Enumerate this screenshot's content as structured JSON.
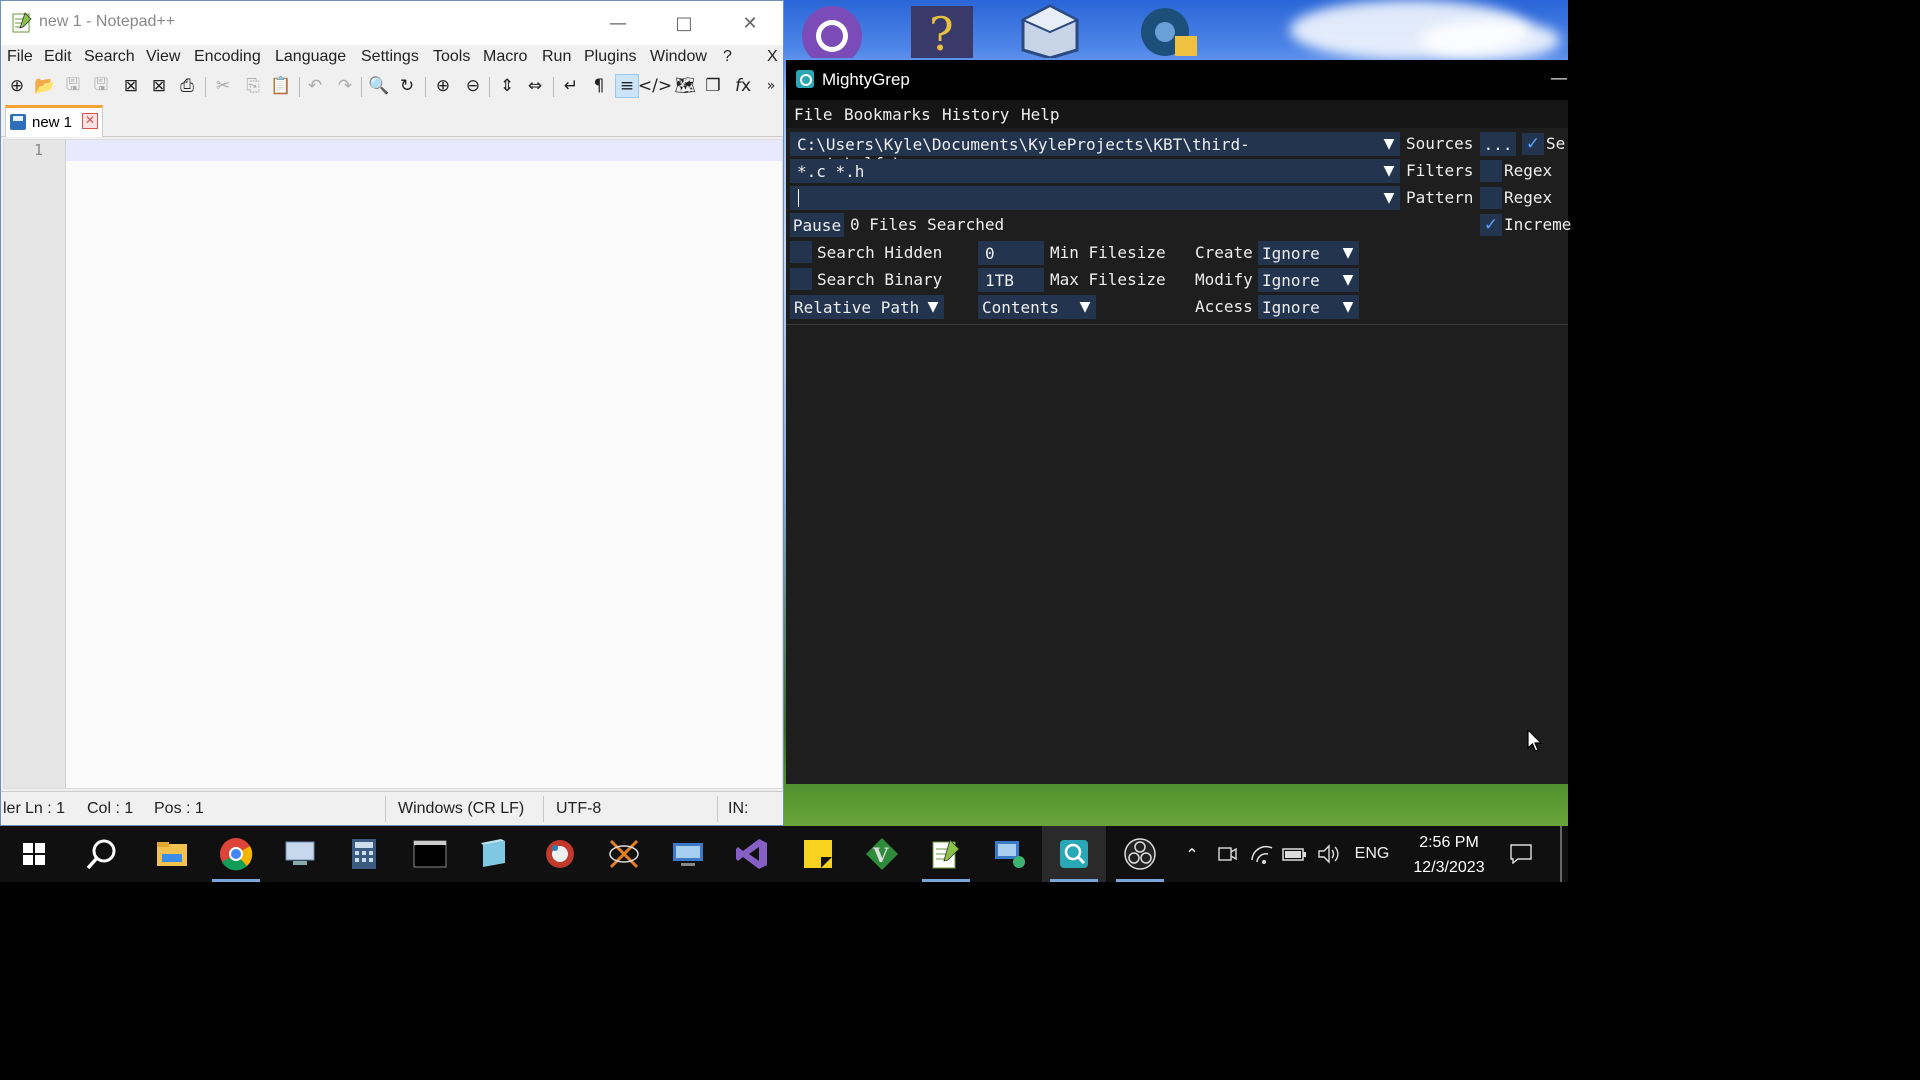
{
  "notepad": {
    "title": "new 1 - Notepad++",
    "menu": [
      "File",
      "Edit",
      "Search",
      "View",
      "Encoding",
      "Language",
      "Settings",
      "Tools",
      "Macro",
      "Run",
      "Plugins",
      "Window",
      "?"
    ],
    "close_x": "X",
    "toolbar_icons": [
      "new-file",
      "open-file",
      "save",
      "save-all",
      "close",
      "close-all",
      "print",
      "cut",
      "copy",
      "paste",
      "undo",
      "redo",
      "find",
      "replace",
      "zoom-in",
      "zoom-out",
      "sync-vertical",
      "sync-horizontal",
      "word-wrap",
      "show-all-chars",
      "indent-guide",
      "user-language",
      "document-map",
      "doc-list",
      "function-list",
      "more"
    ],
    "tab_label": "new 1",
    "line_number": "1",
    "status": {
      "type": "ler",
      "ln": "Ln : 1",
      "col": "Col : 1",
      "pos": "Pos : 1",
      "eol": "Windows (CR LF)",
      "encoding": "UTF-8",
      "mode": "IN:"
    }
  },
  "mightygrep": {
    "title": "MightyGrep",
    "menu": [
      "File",
      "Bookmarks",
      "History",
      "Help"
    ],
    "source_path": "C:\\Users\\Kyle\\Documents\\KyleProjects\\KBT\\third-party\\glfw\\src",
    "sources_label": "Sources",
    "browse_label": "...",
    "search_sub_label": "Se",
    "filters_value": "*.c *.h",
    "filters_label": "Filters",
    "regex_label": "Regex",
    "pattern_value": "",
    "pattern_label": "Pattern",
    "pause_label": "Pause",
    "files_searched": "0 Files Searched",
    "incremental_label": "Increme",
    "search_hidden_label": "Search Hidden",
    "search_binary_label": "Search Binary",
    "min_filesize_value": "0",
    "min_filesize_label": "Min Filesize",
    "max_filesize_value": "1TB",
    "max_filesize_label": "Max Filesize",
    "create_label": "Create",
    "modify_label": "Modify",
    "access_label": "Access",
    "create_value": "Ignore",
    "modify_value": "Ignore",
    "access_value": "Ignore",
    "path_mode": "Relative Path",
    "search_mode": "Contents",
    "checked": {
      "sources_subdirs": true,
      "filters_regex": false,
      "pattern_regex": false,
      "incremental": true,
      "search_hidden": false,
      "search_binary": false
    }
  },
  "taskbar": {
    "items": [
      "start",
      "search",
      "file-explorer",
      "chrome",
      "remote-desktop",
      "calculator",
      "terminal",
      "notepad-app",
      "paint",
      "xming",
      "network-manager",
      "visual-studio",
      "sticky-notes",
      "gvim",
      "notepad-plus-plus",
      "remote-connect",
      "mightygrep",
      "obs"
    ],
    "time": "2:56 PM",
    "date": "12/3/2023",
    "language": "ENG"
  },
  "colors": {
    "mg_field": "#23344f",
    "mg_bg": "#1e1e1e",
    "npp_tab_accent": "#f4a531"
  }
}
